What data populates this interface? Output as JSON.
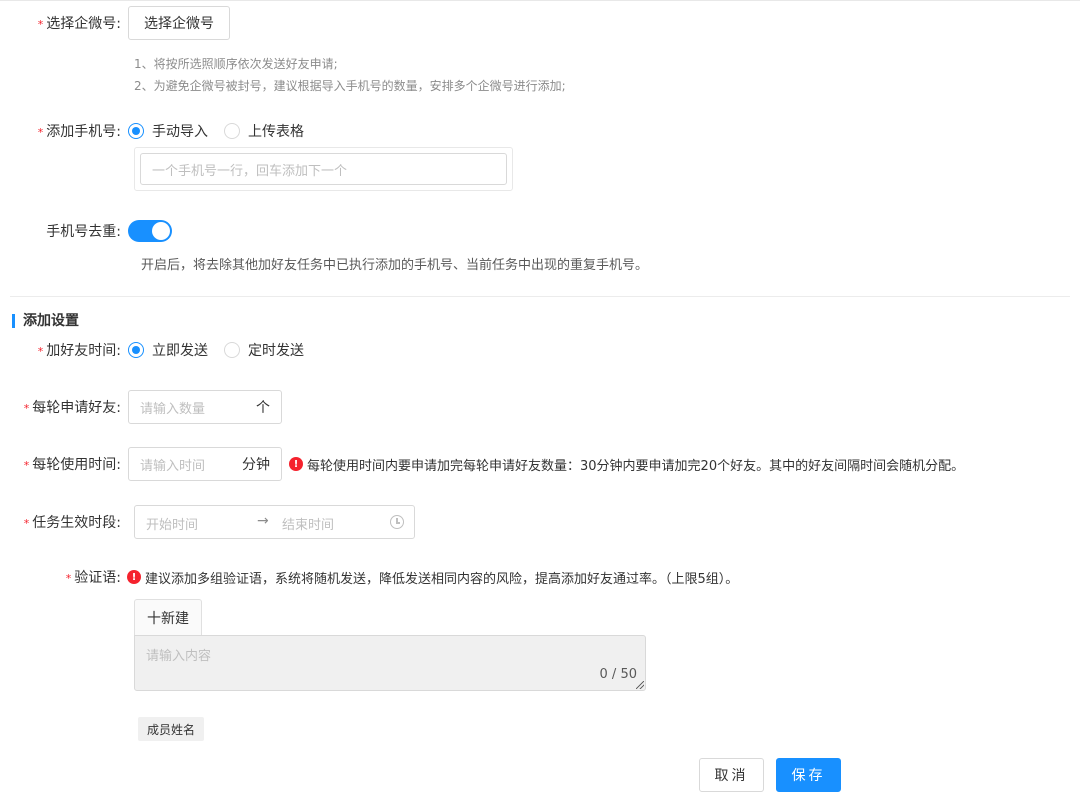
{
  "wecom": {
    "label": "选择企微号",
    "required_mark": "*",
    "button": "选择企微号",
    "hints": [
      "1、将按所选照顺序依次发送好友申请;",
      "2、为避免企微号被封号，建议根据导入手机号的数量，安排多个企微号进行添加;"
    ]
  },
  "phones": {
    "label": "添加手机号",
    "required_mark": "*",
    "options": [
      {
        "label": "手动导入",
        "checked": true
      },
      {
        "label": "上传表格",
        "checked": false
      }
    ],
    "placeholder": "一个手机号一行，回车添加下一个"
  },
  "dedupe": {
    "label": "手机号去重",
    "enabled": true,
    "hint": "开启后，将去除其他加好友任务中已执行添加的手机号、当前任务中出现的重复手机号。"
  },
  "section": {
    "title": "添加设置"
  },
  "add_time": {
    "label": "加好友时间",
    "required_mark": "*",
    "options": [
      {
        "label": "立即发送",
        "checked": true
      },
      {
        "label": "定时发送",
        "checked": false
      }
    ]
  },
  "per_round": {
    "label": "每轮申请好友",
    "required_mark": "*",
    "placeholder": "请输入数量",
    "suffix": "个"
  },
  "round_time": {
    "label": "每轮使用时间",
    "required_mark": "*",
    "placeholder": "请输入时间",
    "suffix": "分钟",
    "notice": "每轮使用时间内要申请加完每轮申请好友数量：30分钟内要申请加完20个好友。其中的好友间隔时间会随机分配。"
  },
  "period": {
    "label": "任务生效时段",
    "required_mark": "*",
    "start_placeholder": "开始时间",
    "end_placeholder": "结束时间",
    "separator": "→"
  },
  "greeting": {
    "label": "验证语",
    "required_mark": "*",
    "notice": "建议添加多组验证语，系统将随机发送，降低发送相同内容的风险，提高添加好友通过率。（上限5组）。",
    "new_button": "十新建",
    "placeholder": "请输入内容",
    "counter": "0 / 50",
    "tag": "成员姓名"
  },
  "footer": {
    "cancel": "取消",
    "save": "保存"
  },
  "colors": {
    "primary": "#1890ff",
    "required": "#f5222d",
    "error_icon": "#f5222d"
  }
}
